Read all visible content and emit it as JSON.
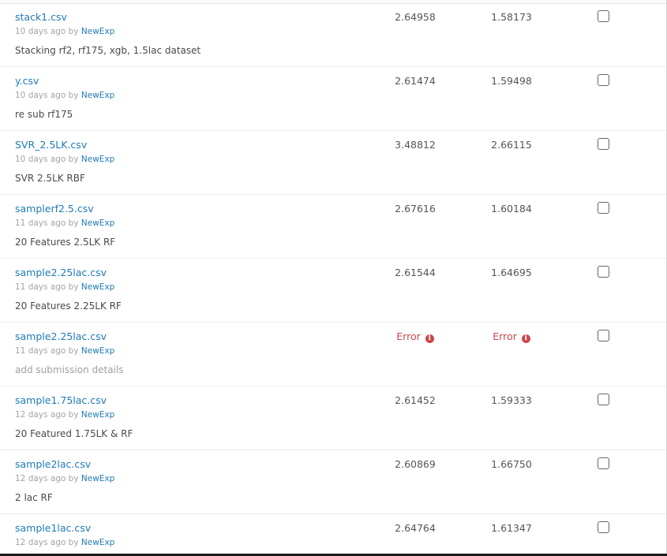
{
  "submissions": [
    {
      "file": "stack1.csv",
      "age": "10 days ago by",
      "author": "NewExp",
      "description": "Stacking rf2, rf175, xgb, 1.5lac dataset",
      "description_placeholder": false,
      "private_score": "2.64958",
      "public_score": "1.58173",
      "error": false
    },
    {
      "file": "y.csv",
      "age": "10 days ago by",
      "author": "NewExp",
      "description": "re sub rf175",
      "description_placeholder": false,
      "private_score": "2.61474",
      "public_score": "1.59498",
      "error": false
    },
    {
      "file": "SVR_2.5LK.csv",
      "age": "10 days ago by",
      "author": "NewExp",
      "description": "SVR 2.5LK RBF",
      "description_placeholder": false,
      "private_score": "3.48812",
      "public_score": "2.66115",
      "error": false
    },
    {
      "file": "samplerf2.5.csv",
      "age": "11 days ago by",
      "author": "NewExp",
      "description": "20 Features 2.5LK RF",
      "description_placeholder": false,
      "private_score": "2.67616",
      "public_score": "1.60184",
      "error": false
    },
    {
      "file": "sample2.25lac.csv",
      "age": "11 days ago by",
      "author": "NewExp",
      "description": "20 Features 2.25LK RF",
      "description_placeholder": false,
      "private_score": "2.61544",
      "public_score": "1.64695",
      "error": false
    },
    {
      "file": "sample2.25lac.csv",
      "age": "11 days ago by",
      "author": "NewExp",
      "description": "add submission details",
      "description_placeholder": true,
      "private_score": "Error",
      "public_score": "Error",
      "error": true
    },
    {
      "file": "sample1.75lac.csv",
      "age": "12 days ago by",
      "author": "NewExp",
      "description": "20 Featured 1.75LK & RF",
      "description_placeholder": false,
      "private_score": "2.61452",
      "public_score": "1.59333",
      "error": false
    },
    {
      "file": "sample2lac.csv",
      "age": "12 days ago by",
      "author": "NewExp",
      "description": "2 lac RF",
      "description_placeholder": false,
      "private_score": "2.60869",
      "public_score": "1.66750",
      "error": false
    },
    {
      "file": "sample1lac.csv",
      "age": "12 days ago by",
      "author": "NewExp",
      "description": "",
      "description_placeholder": false,
      "private_score": "2.64764",
      "public_score": "1.61347",
      "error": false
    }
  ],
  "icons": {
    "error_info": "info-circle-icon",
    "select": "checkbox"
  },
  "colors": {
    "link": "#1f7ab8",
    "error": "#c9474a",
    "muted": "#a3a3a3",
    "text": "#4a4a4a"
  }
}
